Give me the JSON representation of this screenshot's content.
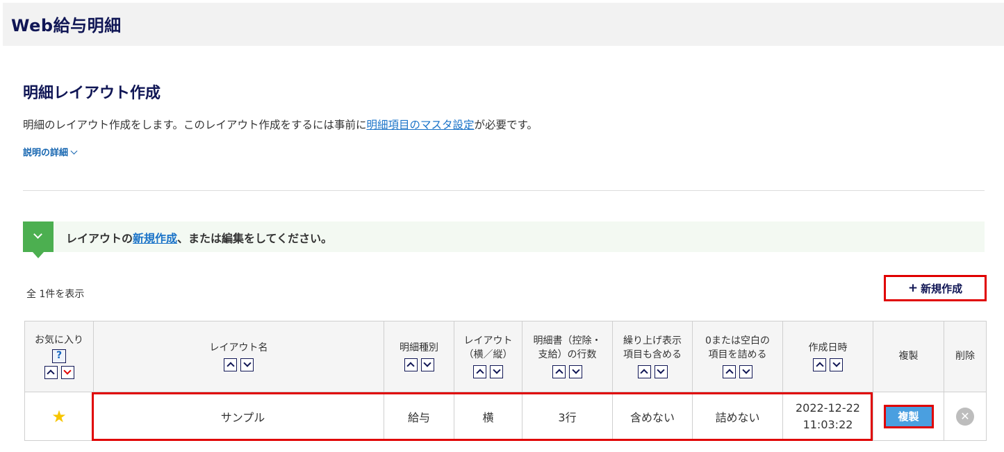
{
  "app": {
    "title": "Web給与明細"
  },
  "page": {
    "title": "明細レイアウト作成",
    "description_prefix": "明細のレイアウト作成をします。このレイアウト作成をするには事前に",
    "description_link": "明細項目のマスタ設定",
    "description_suffix": "が必要です。",
    "details_toggle": "説明の詳細"
  },
  "instruction": {
    "prefix": "レイアウトの",
    "link": "新規作成",
    "suffix": "、または編集をしてください。"
  },
  "toolbar": {
    "record_count": "全 1件を表示",
    "new_label": "新規作成",
    "new_icon": "plus-icon"
  },
  "table": {
    "headers": {
      "favorite": "お気に入り",
      "favorite_help": "?",
      "name": "レイアウト名",
      "type": "明細種別",
      "layout_line1": "レイアウト",
      "layout_line2": "（横／縦）",
      "rows_line1": "明細書（控除・",
      "rows_line2": "支給）の行数",
      "roundup_line1": "繰り上げ表示",
      "roundup_line2": "項目も含める",
      "blank_line1": "0または空白の",
      "blank_line2": "項目を詰める",
      "created": "作成日時",
      "copy": "複製",
      "delete": "削除"
    },
    "rows": [
      {
        "favorite_icon": "star-icon",
        "name": "サンプル",
        "type": "給与",
        "layout": "横",
        "rows": "3行",
        "roundup": "含めない",
        "blank": "詰めない",
        "created_date": "2022-12-22",
        "created_time": "11:03:22",
        "copy_label": "複製",
        "delete_icon": "close-icon"
      }
    ]
  },
  "colors": {
    "header_bg": "#f2f2f2",
    "title": "#101655",
    "link": "#1a73c8",
    "accent_green": "#4caf50",
    "highlight_red": "#e00000",
    "copy_button": "#4a9fe0",
    "star": "#f7c500"
  }
}
